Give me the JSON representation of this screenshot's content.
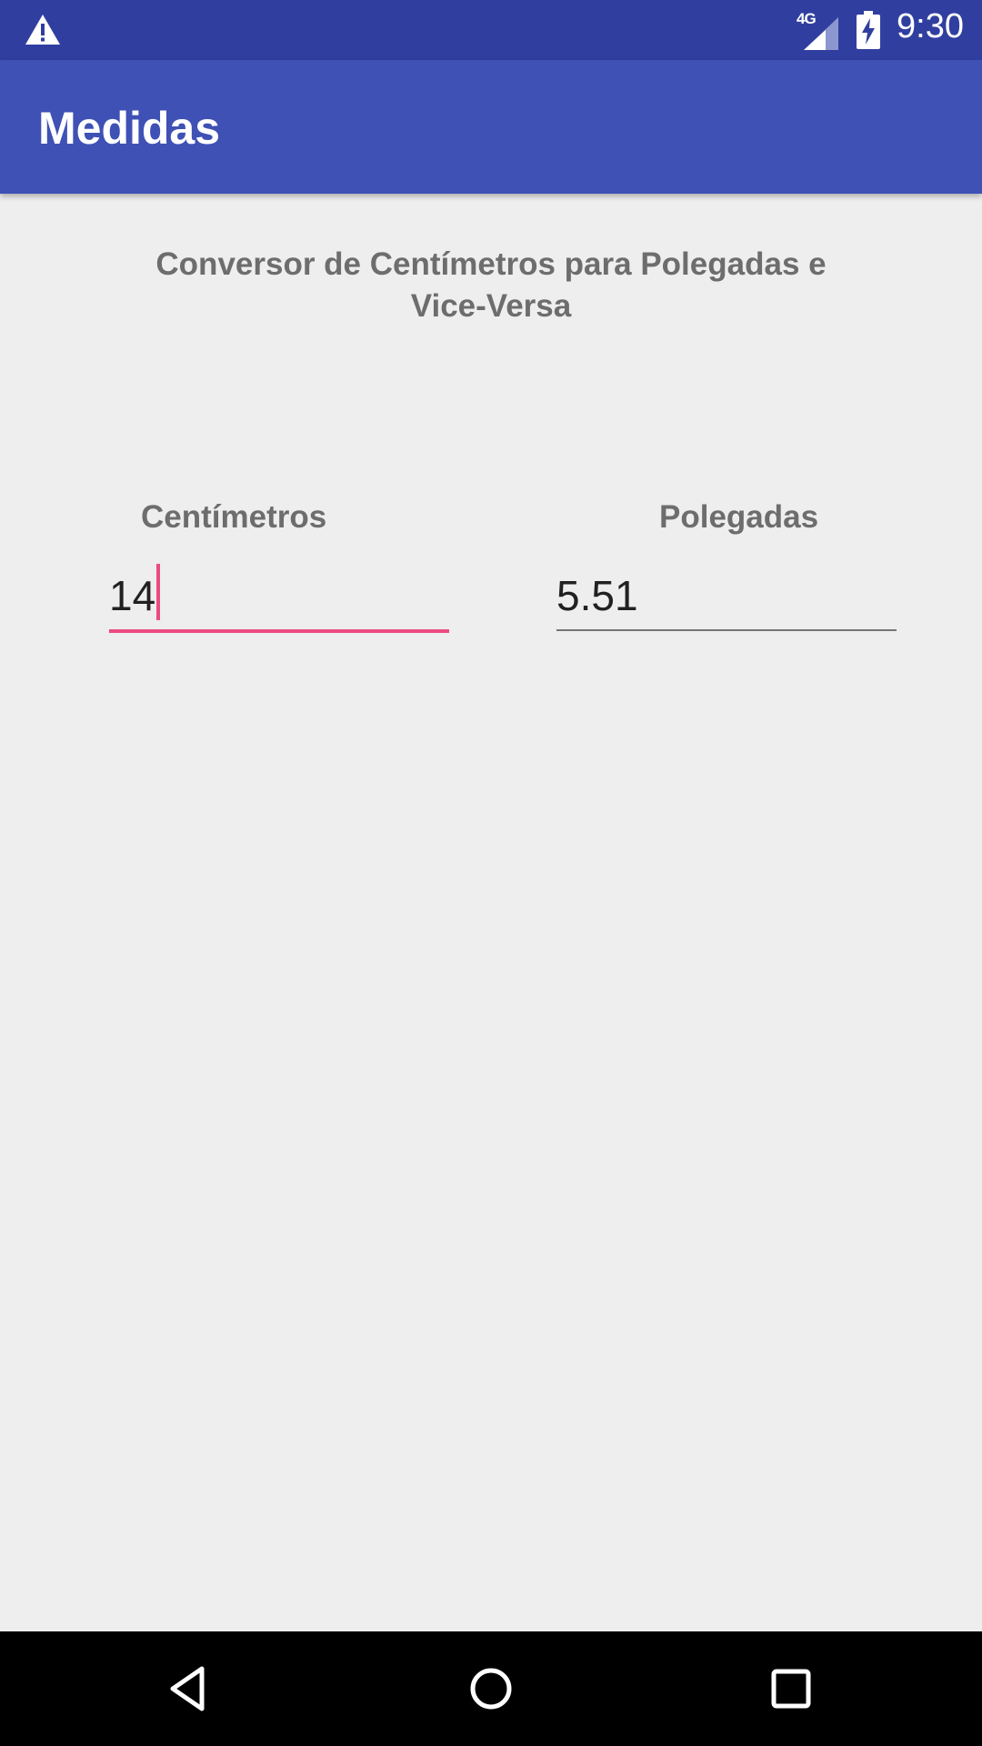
{
  "status_bar": {
    "time": "9:30",
    "network": "4G",
    "icons": [
      "warning-icon",
      "signal-icon",
      "battery-charging-icon"
    ]
  },
  "app_bar": {
    "title": "Medidas"
  },
  "main": {
    "heading": "Conversor de Centímetros para Polegadas e Vice-Versa",
    "centimeters": {
      "label": "Centímetros",
      "value": "14"
    },
    "inches": {
      "label": "Polegadas",
      "value": "5.51"
    }
  },
  "nav_bar": {
    "icons": [
      "back-icon",
      "home-icon",
      "recents-icon"
    ]
  },
  "colors": {
    "status_bar": "#303f9f",
    "app_bar": "#3f51b5",
    "accent": "#ec4a82",
    "background": "#eeeeee",
    "label_text": "#6d6d6d"
  }
}
